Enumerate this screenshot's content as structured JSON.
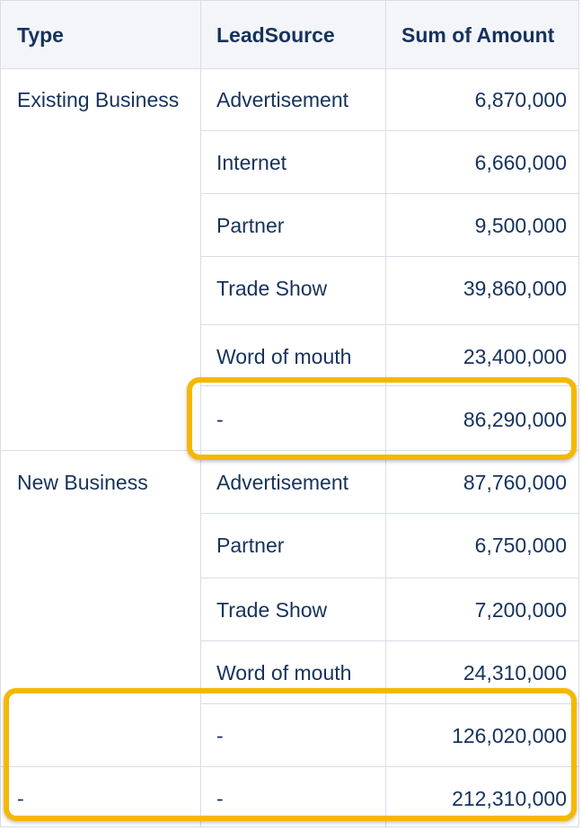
{
  "table": {
    "headers": {
      "type": "Type",
      "lead_source": "LeadSource",
      "amount": "Sum of Amount"
    },
    "groups": [
      {
        "type": "Existing Business",
        "rows": [
          {
            "lead_source": "Advertisement",
            "amount": "6,870,000"
          },
          {
            "lead_source": "Internet",
            "amount": "6,660,000"
          },
          {
            "lead_source": "Partner",
            "amount": "9,500,000"
          },
          {
            "lead_source": "Trade Show",
            "amount": "39,860,000"
          },
          {
            "lead_source": "Word of mouth",
            "amount": "23,400,000"
          },
          {
            "lead_source": "-",
            "amount": "86,290,000"
          }
        ]
      },
      {
        "type": "New Business",
        "rows": [
          {
            "lead_source": "Advertisement",
            "amount": "87,760,000"
          },
          {
            "lead_source": "Partner",
            "amount": "6,750,000"
          },
          {
            "lead_source": "Trade Show",
            "amount": "7,200,000"
          },
          {
            "lead_source": "Word of mouth",
            "amount": "24,310,000"
          },
          {
            "lead_source": "-",
            "amount": "126,020,000"
          }
        ]
      }
    ],
    "grand_total": {
      "type": "-",
      "lead_source": "-",
      "amount": "212,310,000"
    }
  },
  "colors": {
    "text": "#16325c",
    "header_bg": "#f3f5f8",
    "border": "#d8dde6",
    "highlight": "#f5b800"
  }
}
